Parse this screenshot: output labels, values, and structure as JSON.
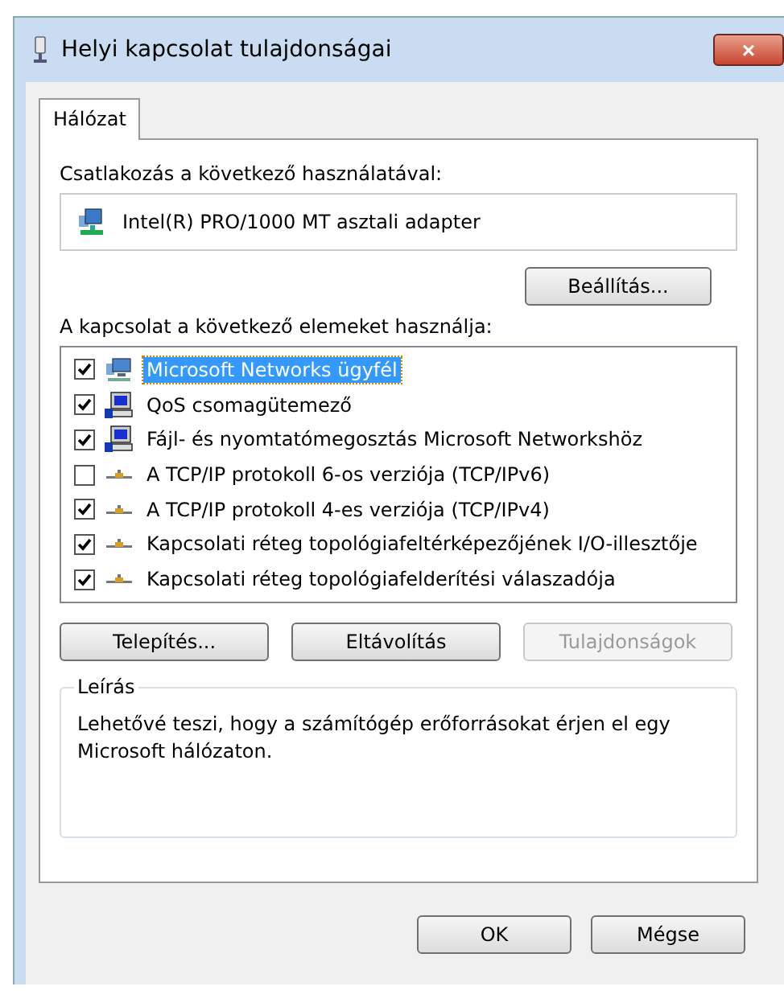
{
  "window": {
    "title": "Helyi kapcsolat tulajdonságai",
    "close": "×"
  },
  "tabs": [
    {
      "label": "Hálózat",
      "selected": true
    }
  ],
  "connect_label": "Csatlakozás a következő használatával:",
  "adapter": "Intel(R) PRO/1000 MT asztali adapter",
  "configure_button": "Beállítás...",
  "items_label": "A kapcsolat a következő elemeket használja:",
  "items": [
    {
      "label": "Microsoft Networks ügyfél",
      "kind": "client",
      "checked": true,
      "selected": true
    },
    {
      "label": "QoS csomagütemező",
      "kind": "service",
      "checked": true,
      "selected": false
    },
    {
      "label": "Fájl- és nyomtatómegosztás Microsoft Networkshöz",
      "kind": "service",
      "checked": true,
      "selected": false
    },
    {
      "label": "A TCP/IP protokoll 6-os verziója (TCP/IPv6)",
      "kind": "protocol",
      "checked": false,
      "selected": false
    },
    {
      "label": "A TCP/IP protokoll 4-es verziója (TCP/IPv4)",
      "kind": "protocol",
      "checked": true,
      "selected": false
    },
    {
      "label": "Kapcsolati réteg topológiafeltérképezőjének I/O-illesztője",
      "kind": "protocol",
      "checked": true,
      "selected": false
    },
    {
      "label": "Kapcsolati réteg topológiafelderítési válaszadója",
      "kind": "protocol",
      "checked": true,
      "selected": false
    }
  ],
  "item_buttons": [
    {
      "label": "Telepítés...",
      "disabled": false
    },
    {
      "label": "Eltávolítás",
      "disabled": false
    },
    {
      "label": "Tulajdonságok",
      "disabled": true
    }
  ],
  "description": {
    "title": "Leírás",
    "text": "Lehetővé teszi, hogy a számítógép erőforrásokat érjen el egy Microsoft hálózaton."
  },
  "dialog_buttons": [
    "OK",
    "Mégse"
  ]
}
